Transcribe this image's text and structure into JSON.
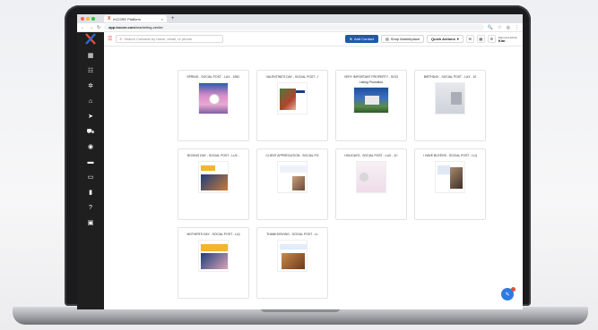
{
  "browser": {
    "tab_title": "inCORE Platform",
    "url_domain": "app.incore.com",
    "url_path": "/marketing-center"
  },
  "header": {
    "search_placeholder": "Search Contacts by name, email, or phone",
    "add_contact_label": "Add Contact",
    "shop_marketplace_label": "Shop Marketplace",
    "quick_actions_label": "Quick Actions",
    "account_line": "Diamond Admin",
    "account_name": "Kim"
  },
  "cards": [
    {
      "title": "SPRING - SOCIAL POST - LUX - 108C",
      "theme": "spring"
    },
    {
      "title": "VALENTINE'S DAY - SOCIAL POST - I",
      "theme": "valentine"
    },
    {
      "title": "VERY IMPORTANT PROPERTY - SOCI",
      "theme": "property",
      "subtitle": "Listing Promotion"
    },
    {
      "title": "BIRTHDAY - SOCIAL POST - LUX - 10",
      "theme": "birthday"
    },
    {
      "title": "BOXING DAY - SOCIAL POST - LUX -",
      "theme": "boxing"
    },
    {
      "title": "CLIENT APPRECIATION - SOCIAL PO",
      "theme": "client"
    },
    {
      "title": "HOLIDAYS - SOCIAL POST - LUX - 1C",
      "theme": "holidays"
    },
    {
      "title": "I HAVE BUYERS - SOCIAL POST - LU)",
      "theme": "buyers"
    },
    {
      "title": "MOTHER'S DAY - SOCIAL POST - LU)",
      "theme": "mothers"
    },
    {
      "title": "THANKSGIVING - SOCIAL POST - LL",
      "theme": "thanksgiving"
    }
  ],
  "colors": {
    "primary": "#1e5aa8",
    "accent": "#e74c3c",
    "sidebar": "#1f1f1f"
  }
}
